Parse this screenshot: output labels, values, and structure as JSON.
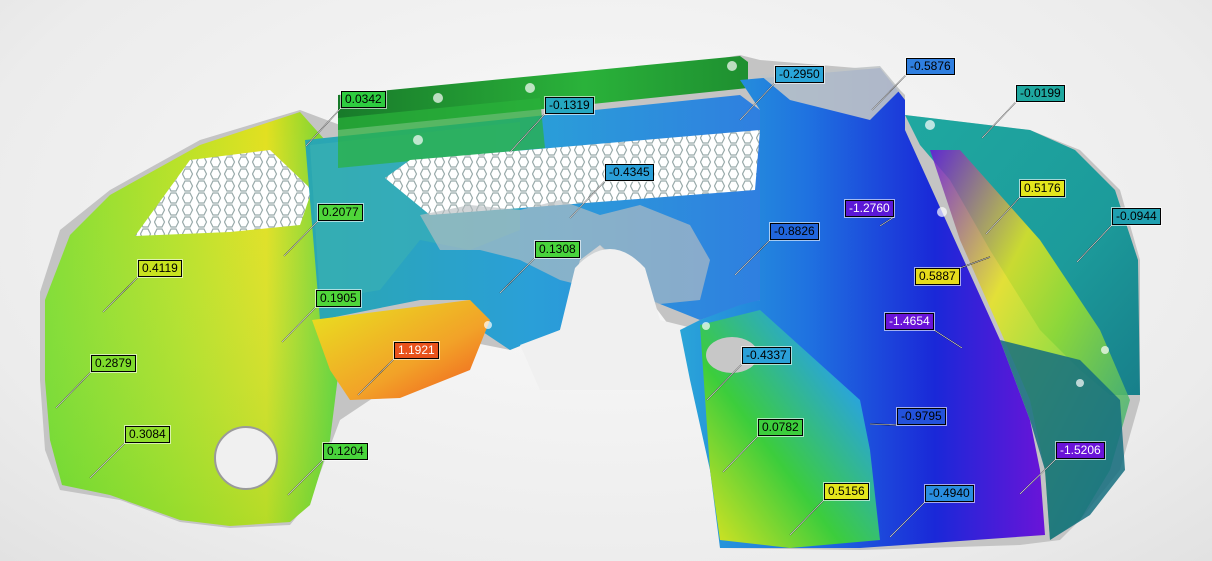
{
  "viewer": {
    "colors": {
      "background": "#efefef",
      "unscanned": "#bdbdbd",
      "red": "#f0561e",
      "orange": "#f2a228",
      "yellow": "#e8e51f",
      "light_green": "#9fe32a",
      "green": "#3cd43a",
      "dark_green": "#1d8a2e",
      "teal": "#1c9b9b",
      "cyan": "#2aa5d8",
      "blue": "#1857e0",
      "deep_blue": "#1a20d8",
      "purple": "#6a14d8"
    },
    "callouts": [
      {
        "id": "c01",
        "label": "0.0342",
        "color": "#2ecc40"
      },
      {
        "id": "c02",
        "label": "-0.1319",
        "color": "#25a7c0"
      },
      {
        "id": "c03",
        "label": "-0.2950",
        "color": "#2aa5d8"
      },
      {
        "id": "c04",
        "label": "-0.5876",
        "color": "#2f7fe0"
      },
      {
        "id": "c05",
        "label": "-0.0199",
        "color": "#1fa8a0"
      },
      {
        "id": "c06",
        "label": "-0.4345",
        "color": "#2a9fd8"
      },
      {
        "id": "c07",
        "label": "0.2077",
        "color": "#4fd63a"
      },
      {
        "id": "c08",
        "label": "-1.2760",
        "color": "#5b18d6"
      },
      {
        "id": "c09",
        "label": "0.5176",
        "color": "#e4e61c"
      },
      {
        "id": "c10",
        "label": "-0.0944",
        "color": "#1f9fb0"
      },
      {
        "id": "c11",
        "label": "-0.8826",
        "color": "#2166dc"
      },
      {
        "id": "c12",
        "label": "0.1308",
        "color": "#49d43c"
      },
      {
        "id": "c13",
        "label": "0.4119",
        "color": "#c9e31f"
      },
      {
        "id": "c14",
        "label": "0.5887",
        "color": "#e6dc1c"
      },
      {
        "id": "c15",
        "label": "0.1905",
        "color": "#4fd63a"
      },
      {
        "id": "c16",
        "label": "-1.4654",
        "color": "#6a14d8"
      },
      {
        "id": "c17",
        "label": "1.1921",
        "color": "#e8521c"
      },
      {
        "id": "c18",
        "label": "0.2879",
        "color": "#7fdc2c"
      },
      {
        "id": "c19",
        "label": "-0.4337",
        "color": "#2aa0d8"
      },
      {
        "id": "c20",
        "label": "-0.9795",
        "color": "#2352dc"
      },
      {
        "id": "c21",
        "label": "0.3084",
        "color": "#8fdd2a"
      },
      {
        "id": "c22",
        "label": "0.0782",
        "color": "#3ccd3c"
      },
      {
        "id": "c23",
        "label": "0.1204",
        "color": "#49d43c"
      },
      {
        "id": "c24",
        "label": "-1.5206",
        "color": "#6a14d8"
      },
      {
        "id": "c25",
        "label": "0.5156",
        "color": "#e4e61c"
      },
      {
        "id": "c26",
        "label": "-0.4940",
        "color": "#2a8ee0"
      }
    ]
  }
}
